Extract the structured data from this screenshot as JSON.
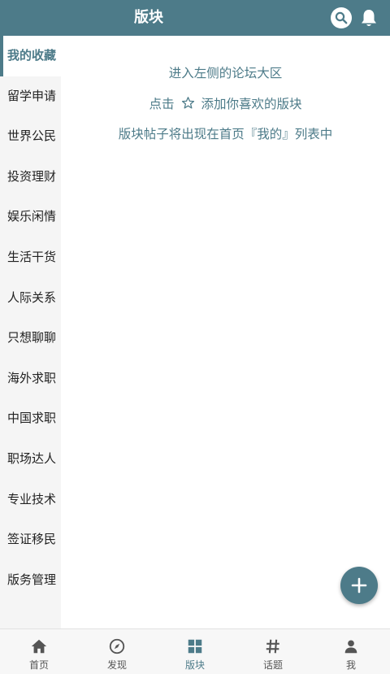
{
  "header": {
    "title": "版块",
    "search_icon": "search-icon",
    "bell_icon": "bell-icon"
  },
  "sidebar": {
    "items": [
      {
        "label": "我的收藏",
        "active": true
      },
      {
        "label": "留学申请"
      },
      {
        "label": "世界公民"
      },
      {
        "label": "投资理财"
      },
      {
        "label": "娱乐闲情"
      },
      {
        "label": "生活干货"
      },
      {
        "label": "人际关系"
      },
      {
        "label": "只想聊聊"
      },
      {
        "label": "海外求职"
      },
      {
        "label": "中国求职"
      },
      {
        "label": "职场达人"
      },
      {
        "label": "专业技术"
      },
      {
        "label": "签证移民"
      },
      {
        "label": "版务管理"
      }
    ]
  },
  "main": {
    "hint_line1": "进入左侧的论坛大区",
    "hint_line2_prefix": "点击",
    "hint_line2_icon": "star-outline-icon",
    "hint_line2_suffix": "添加你喜欢的版块",
    "hint_line3": "版块帖子将出现在首页『我的』列表中"
  },
  "fab": {
    "icon": "plus-icon"
  },
  "tabbar": {
    "tabs": [
      {
        "label": "首页",
        "icon": "home-icon"
      },
      {
        "label": "发现",
        "icon": "compass-icon"
      },
      {
        "label": "版块",
        "icon": "grid-icon",
        "active": true
      },
      {
        "label": "话题",
        "icon": "hashtag-icon"
      },
      {
        "label": "我",
        "icon": "person-icon"
      }
    ]
  },
  "colors": {
    "accent": "#4d7b89",
    "sidebar_bg": "#f5f5f5",
    "tabbar_bg": "#f7f7f7"
  }
}
